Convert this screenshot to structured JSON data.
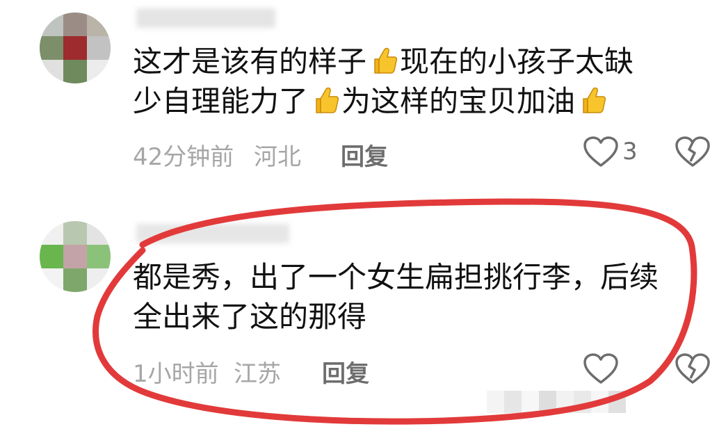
{
  "comments": [
    {
      "username": "",
      "text_line1_a": "这才是该有的样子",
      "text_line1_b": "现在的小孩子太缺",
      "text_line2_a": "少自理能力了",
      "text_line2_b": "为这样的宝贝加油",
      "time": "42分钟前",
      "location": "河北",
      "reply": "回复",
      "likes": "3"
    },
    {
      "username": "",
      "text_line1": "都是秀，出了一个女生扁担挑行李，后续",
      "text_line2": "全出来了这的那得",
      "time": "1小时前",
      "location": "江苏",
      "reply": "回复"
    }
  ],
  "icons": {
    "emoji": "thumbs-up-icon",
    "like": "heart-icon",
    "dislike": "broken-heart-icon"
  },
  "colors": {
    "annotation": "#e23a3a",
    "meta": "#a6a6a6",
    "reply": "#6d6d6d"
  }
}
